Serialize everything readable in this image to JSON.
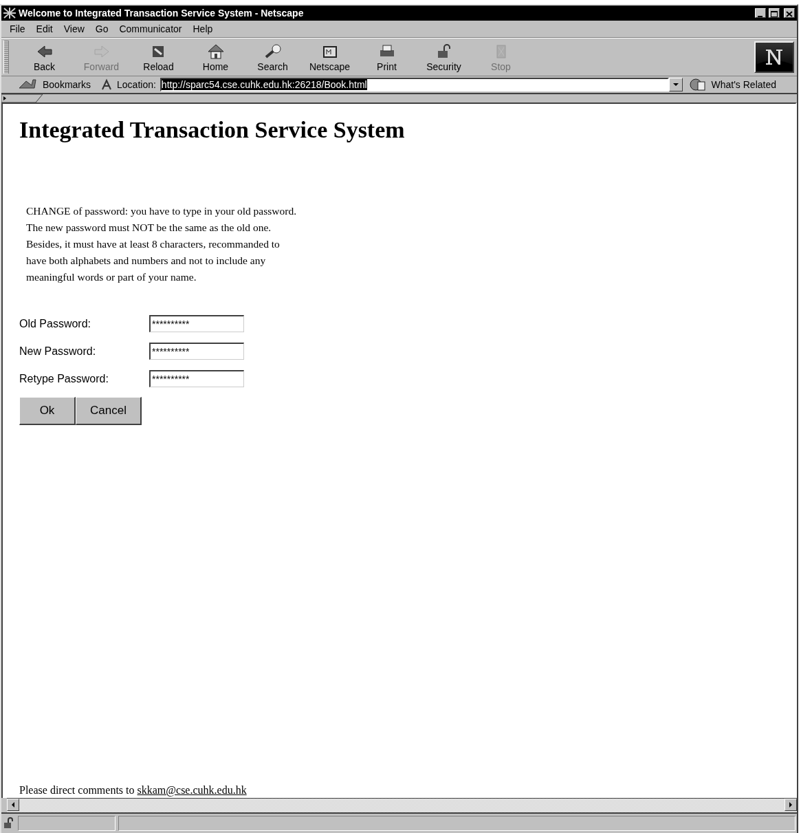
{
  "window": {
    "title": "Welcome to Integrated Transaction Service System - Netscape"
  },
  "menu": [
    "File",
    "Edit",
    "View",
    "Go",
    "Communicator",
    "Help"
  ],
  "toolbar": [
    {
      "label": "Back",
      "disabled": false
    },
    {
      "label": "Forward",
      "disabled": true
    },
    {
      "label": "Reload",
      "disabled": false
    },
    {
      "label": "Home",
      "disabled": false
    },
    {
      "label": "Search",
      "disabled": false
    },
    {
      "label": "Netscape",
      "disabled": false
    },
    {
      "label": "Print",
      "disabled": false
    },
    {
      "label": "Security",
      "disabled": false
    },
    {
      "label": "Stop",
      "disabled": true
    }
  ],
  "location_bar": {
    "bookmarks": "Bookmarks",
    "label": "Location:",
    "url": "http://sparc54.cse.cuhk.edu.hk:26218/Book.html",
    "related": "What's Related"
  },
  "page": {
    "heading": "Integrated Transaction Service System",
    "instructions": "CHANGE of password: you have to type in your old password.\nThe new password must NOT be the same as the old one.\nBesides, it must have at least 8 characters, recommanded to\nhave both alphabets and numbers and not to include any\nmeaningful words or part of your name.",
    "fields": [
      {
        "label": "Old Password:",
        "value": "**********"
      },
      {
        "label": "New Password:",
        "value": "**********"
      },
      {
        "label": "Retype Password:",
        "value": "**********"
      }
    ],
    "buttons": [
      "Ok",
      "Cancel"
    ],
    "footer": {
      "text": "Please direct comments to",
      "link": "skkam@cse.cuhk.edu.hk"
    }
  }
}
